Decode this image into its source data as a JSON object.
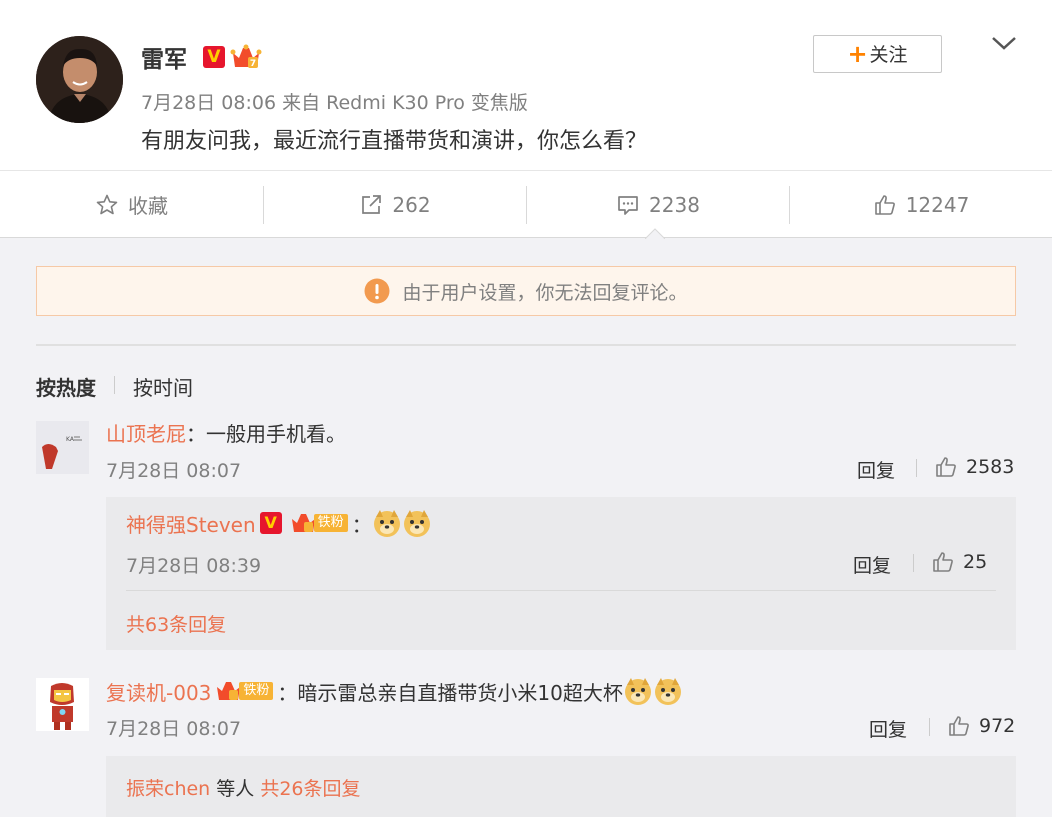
{
  "post": {
    "username": "雷军",
    "v_badge": "V",
    "meta": "7月28日 08:06 来自 Redmi K30 Pro 变焦版",
    "text": "有朋友问我，最近流行直播带货和演讲，你怎么看？",
    "follow_label": "关注",
    "follow_plus": "+"
  },
  "actions": {
    "favorite": "收藏",
    "repost_count": "262",
    "comment_count": "2238",
    "like_count": "12247"
  },
  "notice": "由于用户设置，你无法回复评论。",
  "sort": {
    "hot": "按热度",
    "time": "按时间"
  },
  "comments": [
    {
      "user": "山顶老屁",
      "text": "：一般用手机看。",
      "time": "7月28日 08:07",
      "reply_label": "回复",
      "likes": "2583",
      "sub": {
        "user": "神得强Steven",
        "v_badge": "V",
        "fan_label": "铁粉",
        "colon": "：",
        "time": "7月28日 08:39",
        "reply_label": "回复",
        "likes": "25",
        "more": "共63条回复"
      }
    },
    {
      "user": "复读机-003",
      "fan_label": "铁粉",
      "text": "：暗示雷总亲自直播带货小米10超大杯",
      "time": "7月28日 08:07",
      "reply_label": "回复",
      "likes": "972",
      "sub_users": "振荣chen",
      "sub_etc": " 等人 ",
      "sub_more": "共26条回复"
    }
  ],
  "colors": {
    "accent": "#eb7350",
    "orange": "#ff8200",
    "vbadge": "#e6162d"
  }
}
